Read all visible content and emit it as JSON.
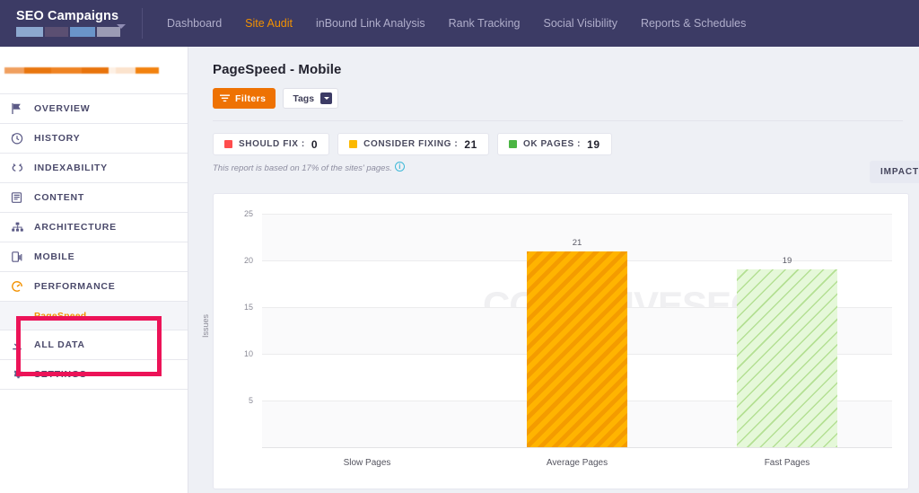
{
  "topnav": {
    "brand_title": "SEO Campaigns",
    "brand_redact_blocks": [
      "#8ca8cf",
      "#5b4f72",
      "#6a94c9",
      "#9b9bb4"
    ],
    "caret_icon": "chevron-down-icon",
    "links": [
      {
        "label": "Dashboard",
        "active": false
      },
      {
        "label": "Site Audit",
        "active": true
      },
      {
        "label": "inBound Link Analysis",
        "active": false
      },
      {
        "label": "Rank Tracking",
        "active": false
      },
      {
        "label": "Social Visibility",
        "active": false
      },
      {
        "label": "Reports & Schedules",
        "active": false
      }
    ]
  },
  "sidebar": {
    "site_redact_blocks": [
      "#f0a060",
      "#e8760f",
      "#ef8322",
      "#e8740c",
      "#fdf0e4",
      "#fbe3cd",
      "#f2820f"
    ],
    "items": [
      {
        "label": "OVERVIEW",
        "icon": "flag-icon"
      },
      {
        "label": "HISTORY",
        "icon": "clock-icon"
      },
      {
        "label": "INDEXABILITY",
        "icon": "link-icon"
      },
      {
        "label": "CONTENT",
        "icon": "document-icon"
      },
      {
        "label": "ARCHITECTURE",
        "icon": "sitemap-icon"
      },
      {
        "label": "MOBILE",
        "icon": "mobile-icon"
      },
      {
        "label": "PERFORMANCE",
        "icon": "gauge-icon"
      },
      {
        "label": "PageSpeed",
        "icon": "none",
        "sub": true,
        "selected": true
      },
      {
        "label": "ALL DATA",
        "icon": "download-icon"
      },
      {
        "label": "SETTINGS",
        "icon": "gear-icon"
      }
    ],
    "highlight_color": "#ec1358"
  },
  "main": {
    "page_title": "PageSpeed - Mobile",
    "filters_label": "Filters",
    "filters_icon": "funnel-icon",
    "tags_label": "Tags",
    "tags_caret_icon": "chevron-down-icon",
    "impact_label": "IMPACT",
    "note_text": "This report is based on 17% of the sites' pages.",
    "note_icon": "info-icon",
    "chips": [
      {
        "label": "SHOULD FIX :",
        "value": "0",
        "color": "#ff4d4d"
      },
      {
        "label": "CONSIDER FIXING :",
        "value": "21",
        "color": "#fcb900"
      },
      {
        "label": "OK PAGES :",
        "value": "19",
        "color": "#4bb543"
      }
    ]
  },
  "chart_data": {
    "type": "bar",
    "title": "",
    "watermark": "COGNITIVESEO",
    "categories": [
      "Slow Pages",
      "Average Pages",
      "Fast Pages"
    ],
    "values": [
      0,
      21,
      19
    ],
    "bar_colors": [
      "#ffb400",
      "#ffb400",
      "#e5f8d9"
    ],
    "xlabel": "",
    "ylabel": "Issues",
    "ylim": [
      0,
      25
    ],
    "yticks": [
      5,
      10,
      15,
      20,
      25
    ],
    "grid": true,
    "legend": "none"
  }
}
